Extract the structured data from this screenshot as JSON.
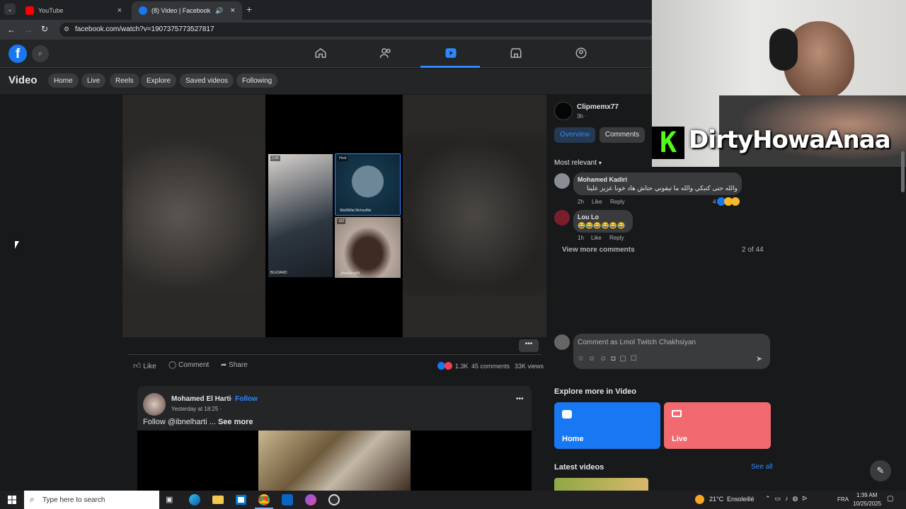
{
  "browser": {
    "tabs": [
      {
        "label": "YouTube"
      },
      {
        "label": "(8) Video | Facebook"
      }
    ],
    "url": "facebook.com/watch?v=1907375773527817"
  },
  "fb": {
    "subnav": {
      "title": "Video",
      "pills": [
        "Home",
        "Live",
        "Reels",
        "Explore",
        "Saved videos",
        "Following"
      ]
    }
  },
  "video": {
    "stream": {
      "tile_badges": [
        "2.6K",
        "Host",
        "182"
      ],
      "tiles": [
        "BLEDARD",
        "WaWWat MohssiNe",
        "_blackking09"
      ]
    },
    "actions": {
      "like": "Like",
      "comment": "Comment",
      "share": "Share",
      "reactions": "1.3K",
      "comments": "45 comments",
      "views": "33K views"
    }
  },
  "overlay": {
    "brand": "DirtyHowaAnaa"
  },
  "panel": {
    "author": "Clipmemx77",
    "time": "3h ·",
    "tabs": [
      "Overview",
      "Comments"
    ],
    "sort": "Most relevant",
    "comments": [
      {
        "name": "Mohamed Kadiri",
        "text": "والله حتى كتبكي والله ما تيقوني حتاش هاد خونا عزيز علينا",
        "time": "2h",
        "like": "Like",
        "reply": "Reply",
        "count": "4"
      },
      {
        "name": "Lou Lo",
        "text": "😂😂😂😂😂😂",
        "time": "1h",
        "like": "Like",
        "reply": "Reply"
      }
    ],
    "view_more": "View more comments",
    "count": "2 of 44",
    "compose_placeholder": "Comment as Lmol Twitch Chakhsiyan"
  },
  "post": {
    "author": "Mohamed El Harti",
    "follow": "· Follow",
    "time": "Yesterday at 18:25 ·",
    "text": "Follow @ibnelharti ...",
    "see_more": "See more"
  },
  "explore": {
    "title": "Explore more in Video",
    "cards": [
      {
        "label": "Home",
        "color": "#1877f2"
      },
      {
        "label": "Live",
        "color": "#f06a6f"
      }
    ],
    "latest": "Latest videos",
    "see_all": "See all"
  },
  "taskbar": {
    "search": "Type here to search",
    "temp": "21°C",
    "weather": "Ensoleillé",
    "lang": "FRA",
    "time": "1:39 AM",
    "date": "10/25/2025"
  }
}
